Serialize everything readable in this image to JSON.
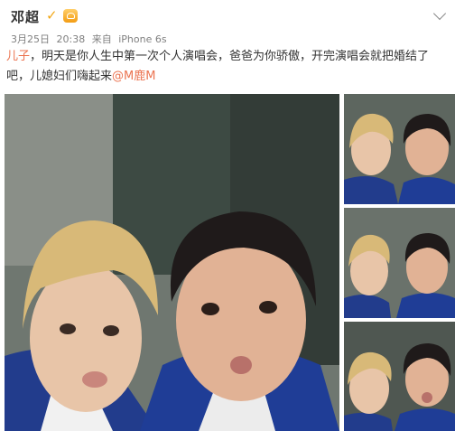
{
  "post": {
    "username": "邓超",
    "date": "3月25日",
    "time": "20:38",
    "source_prefix": "来自",
    "device": "iPhone 6s",
    "text": {
      "highlight_start": "儿子",
      "body": "，明天是你人生中第一次个人演唱会，爸爸为你骄傲，开完演唱会就把婚结了吧，儿媳妇们嗨起来",
      "mention": "@M鹿M"
    }
  },
  "icons": {
    "verified": "verified-v-icon",
    "level": "level-crown-icon",
    "menu": "chevron-down-icon"
  },
  "colors": {
    "link": "#eb7350",
    "text": "#333333",
    "meta": "#808080",
    "verified": "#f2a818"
  },
  "photos": [
    {
      "id": "main-photo"
    },
    {
      "id": "thumbnail-1"
    },
    {
      "id": "thumbnail-2"
    },
    {
      "id": "thumbnail-3"
    }
  ]
}
